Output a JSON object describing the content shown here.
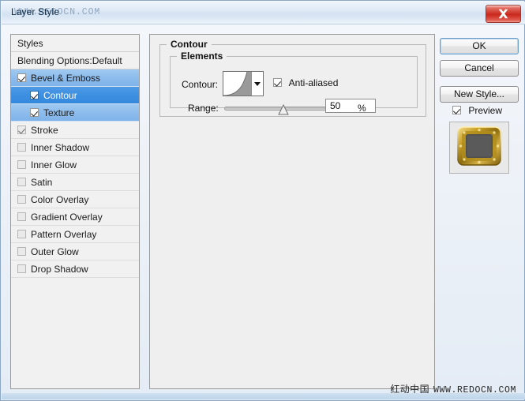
{
  "window": {
    "title": "Layer Style",
    "title_watermark_cn": "",
    "title_watermark_url": "WWW.REDOCN.COM",
    "close_icon": "close-icon"
  },
  "styles_panel": {
    "header": "Styles",
    "blending_options": "Blending Options:Default",
    "effects": [
      {
        "label": "Bevel & Emboss",
        "checked": true,
        "selected": "light",
        "indent": false
      },
      {
        "label": "Contour",
        "checked": true,
        "selected": "strong",
        "indent": true
      },
      {
        "label": "Texture",
        "checked": true,
        "selected": "light",
        "indent": true
      },
      {
        "label": "Stroke",
        "checked": true,
        "selected": "none",
        "indent": false
      },
      {
        "label": "Inner Shadow",
        "checked": false,
        "selected": "none",
        "indent": false
      },
      {
        "label": "Inner Glow",
        "checked": false,
        "selected": "none",
        "indent": false
      },
      {
        "label": "Satin",
        "checked": false,
        "selected": "none",
        "indent": false
      },
      {
        "label": "Color Overlay",
        "checked": false,
        "selected": "none",
        "indent": false
      },
      {
        "label": "Gradient Overlay",
        "checked": false,
        "selected": "none",
        "indent": false
      },
      {
        "label": "Pattern Overlay",
        "checked": false,
        "selected": "none",
        "indent": false
      },
      {
        "label": "Outer Glow",
        "checked": false,
        "selected": "none",
        "indent": false
      },
      {
        "label": "Drop Shadow",
        "checked": false,
        "selected": "none",
        "indent": false
      }
    ]
  },
  "main": {
    "group_title": "Contour",
    "elements_title": "Elements",
    "contour_label": "Contour:",
    "contour_swatch_name": "contour-curve-preview",
    "antialiased_label": "Anti-aliased",
    "antialiased_checked": true,
    "range_label": "Range:",
    "range_value": "50",
    "range_percent": "%",
    "range_slider_position_pct": 52
  },
  "buttons": {
    "ok": "OK",
    "cancel": "Cancel",
    "new_style": "New Style...",
    "preview_label": "Preview",
    "preview_checked": true
  },
  "preview": {
    "thumbnail_name": "gold-frame-preview"
  },
  "footer": {
    "watermark_cn": "红动中国",
    "watermark_url": "WWW.REDOCN.COM"
  },
  "colors": {
    "accent_selected": "#3d8fe0",
    "accent_selected_light": "#8dbced",
    "close_button": "#c9281c",
    "dialog_bg": "#efefef",
    "title_bar": "#dfeaf6"
  }
}
